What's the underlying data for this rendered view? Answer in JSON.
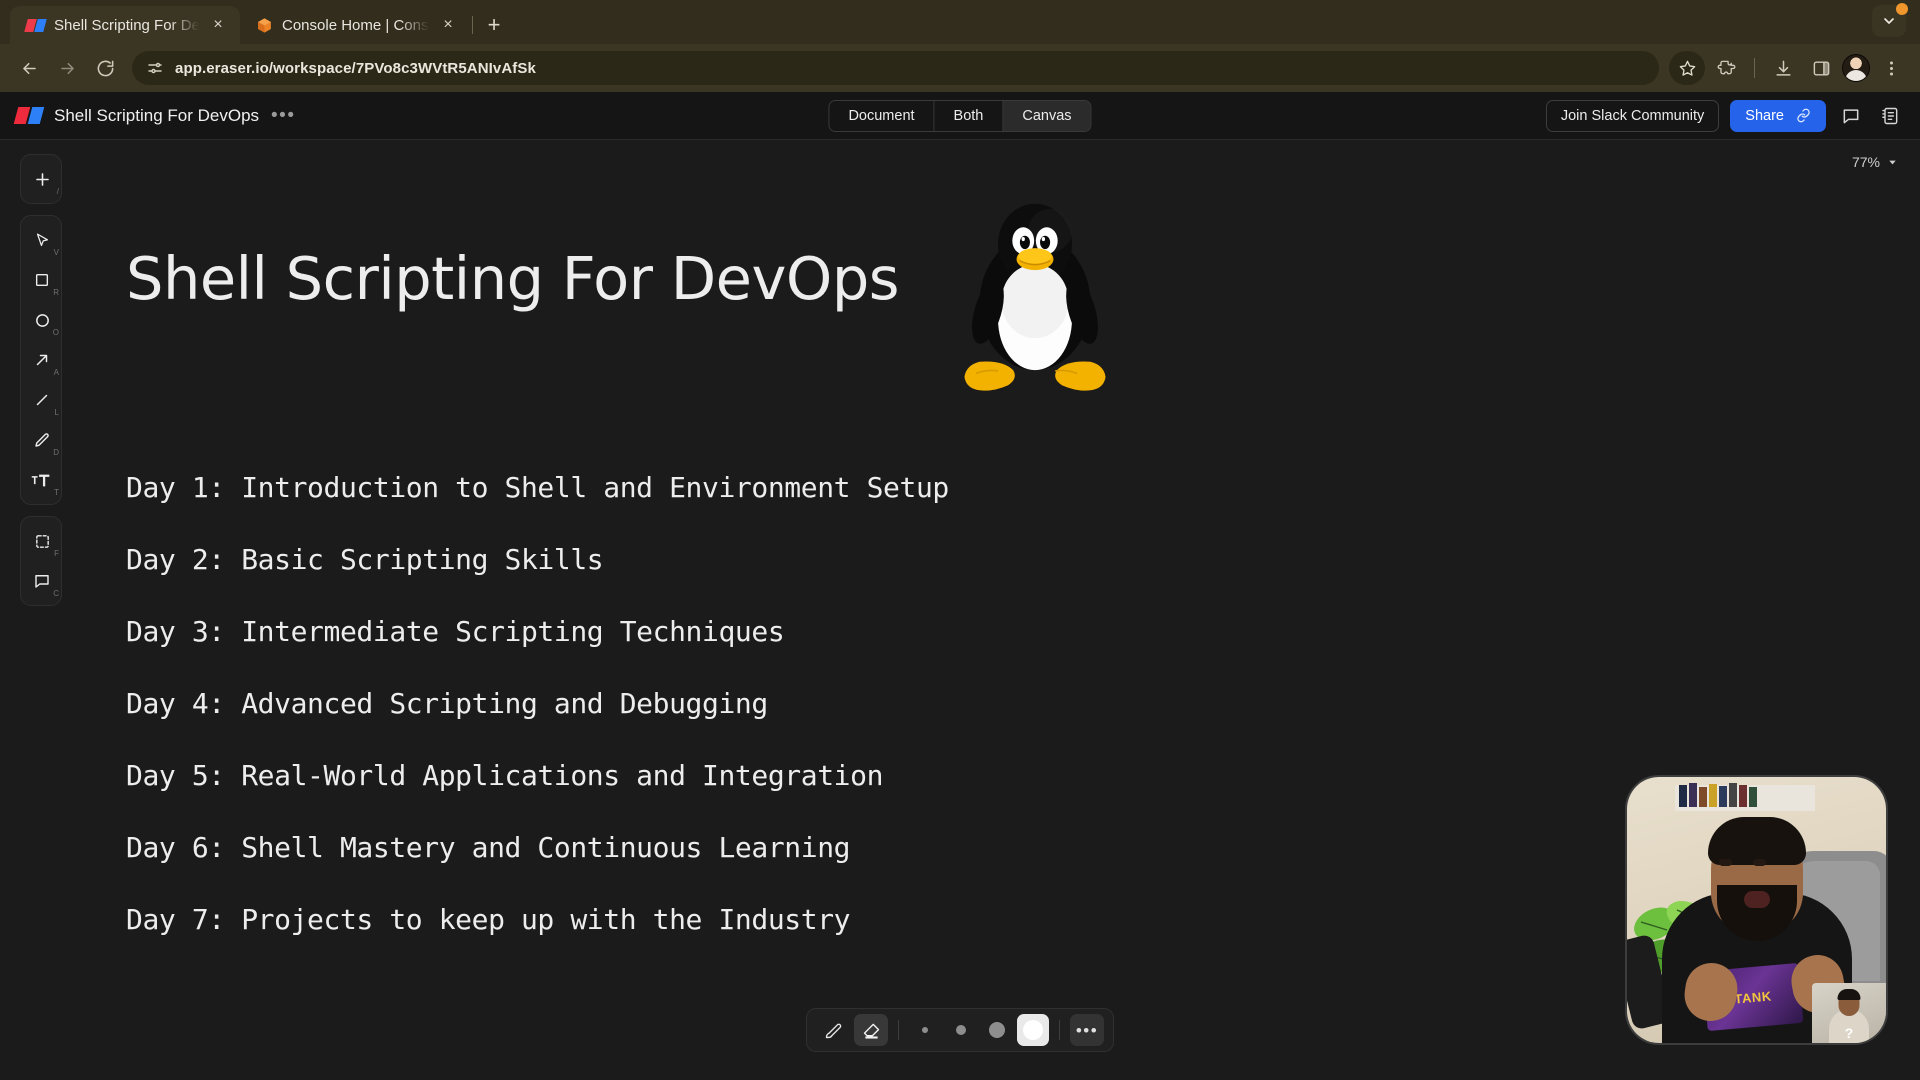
{
  "browser": {
    "tabs": [
      {
        "title": "Shell Scripting For DevOps —",
        "favicon": "eraser-icon",
        "active": true,
        "close_label": "×"
      },
      {
        "title": "Console Home | Console Hom",
        "favicon": "aws-cube-icon",
        "active": false,
        "close_label": "×"
      }
    ],
    "new_tab_label": "+",
    "window_chevron": "chevron-down-icon",
    "nav": {
      "back": "back-arrow-icon",
      "forward": "forward-arrow-icon",
      "reload": "reload-icon",
      "site_info": "site-settings-icon",
      "url": "app.eraser.io/workspace/7PVo8c3WVtR5ANIvAfSk",
      "bookmark": "star-icon",
      "extensions": "puzzle-icon",
      "downloads": "download-icon",
      "side_panel": "side-panel-icon",
      "profile": "avatar",
      "menu": "kebab-menu-icon"
    }
  },
  "app": {
    "logo": "eraser-logo",
    "title": "Shell Scripting For DevOps",
    "title_menu": "•••",
    "view_modes": [
      {
        "label": "Document",
        "active": false
      },
      {
        "label": "Both",
        "active": false
      },
      {
        "label": "Canvas",
        "active": true
      }
    ],
    "slack_button": "Join Slack Community",
    "share_button": "Share",
    "share_icon": "link-icon",
    "comment_icon": "comment-icon",
    "notes_icon": "notes-icon"
  },
  "toolbar": {
    "add": {
      "name": "add-tool",
      "shortcut": "/"
    },
    "tools": [
      {
        "name": "select-tool",
        "icon": "cursor-icon",
        "shortcut": "V"
      },
      {
        "name": "rectangle-tool",
        "icon": "square-icon",
        "shortcut": "R"
      },
      {
        "name": "ellipse-tool",
        "icon": "circle-icon",
        "shortcut": "O"
      },
      {
        "name": "arrow-tool",
        "icon": "arrow-icon",
        "shortcut": "A"
      },
      {
        "name": "line-tool",
        "icon": "line-icon",
        "shortcut": "L"
      },
      {
        "name": "draw-tool",
        "icon": "pencil-icon",
        "shortcut": "D"
      },
      {
        "name": "text-tool",
        "icon": "text-icon",
        "shortcut": "T"
      }
    ],
    "extras": [
      {
        "name": "frame-tool",
        "icon": "frame-icon",
        "shortcut": "F"
      },
      {
        "name": "comment-tool",
        "icon": "comment-bubble-icon",
        "shortcut": "C"
      }
    ]
  },
  "canvas": {
    "zoom_level": "77%",
    "zoom_chevron": "chevron-down-icon",
    "doc_title": "Shell Scripting For DevOps",
    "hero_image": "tux-linux-penguin",
    "days": [
      "Day 1: Introduction to Shell and Environment Setup",
      "Day 2: Basic Scripting Skills",
      "Day 3: Intermediate Scripting Techniques",
      "Day 4: Advanced Scripting and Debugging",
      "Day 5: Real-World Applications and Integration",
      "Day 6: Shell Mastery and Continuous Learning",
      "Day 7: Projects to keep up with the Industry"
    ]
  },
  "pen_bar": {
    "pen": {
      "icon": "pen-icon",
      "active": false
    },
    "eraser": {
      "icon": "eraser-icon",
      "active": true
    },
    "sizes": [
      {
        "label": "extra-small",
        "diameter": 6,
        "active": false
      },
      {
        "label": "small",
        "diameter": 10,
        "active": false
      },
      {
        "label": "medium",
        "diameter": 16,
        "active": false
      },
      {
        "label": "large",
        "diameter": 20,
        "active": true
      }
    ],
    "more": "•••"
  },
  "webcam": {
    "label": "webcam-overlay",
    "pack_text": "TANK",
    "thumb_label": "?"
  },
  "colors": {
    "accent_blue": "#2563eb",
    "brand_red": "#ee2b3c",
    "brand_blue": "#2e80f7",
    "canvas_bg": "#1b1b1b",
    "chrome_bg": "#3b3523"
  }
}
